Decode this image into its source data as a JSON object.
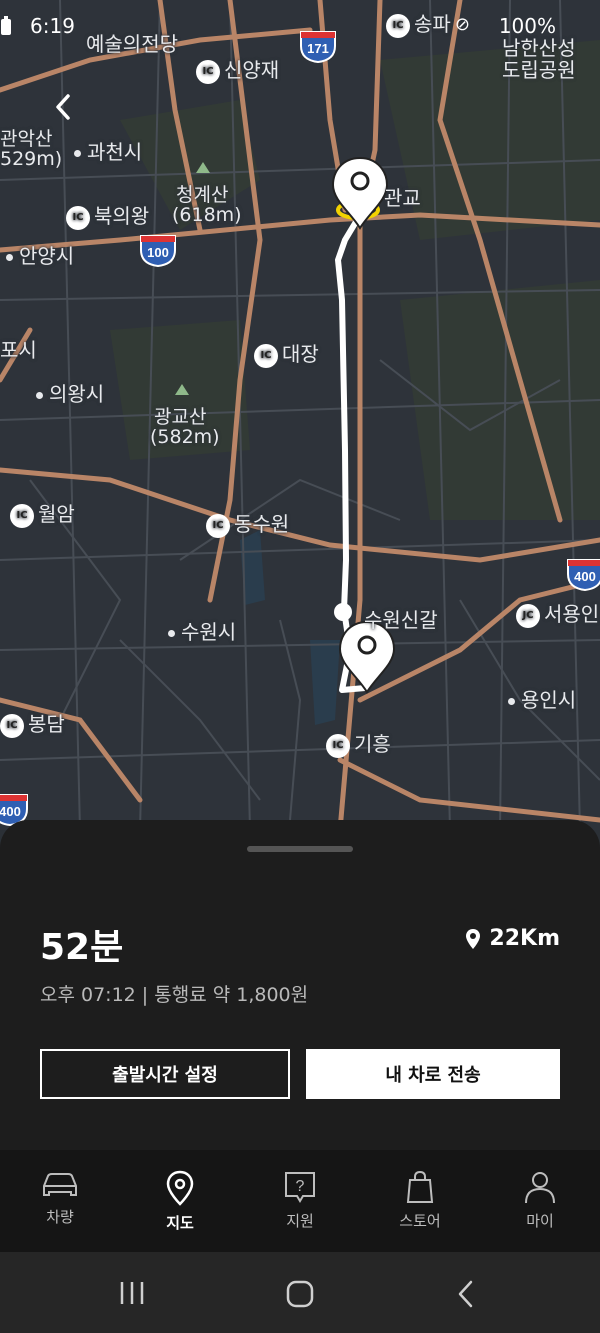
{
  "status_bar": {
    "time": "6:19",
    "battery": "100%"
  },
  "map": {
    "labels": [
      {
        "text": "예술의전당"
      },
      {
        "text": "신양재",
        "ic": "IC"
      },
      {
        "text": "송파",
        "ic": "IC"
      },
      {
        "text": "남한산성"
      },
      {
        "text": "도립공원"
      },
      {
        "text": "관악산"
      },
      {
        "text": "529m)"
      },
      {
        "text": "과천시"
      },
      {
        "text": "청계산"
      },
      {
        "text": "(618m)"
      },
      {
        "text": "북의왕",
        "ic": "IC"
      },
      {
        "text": "관교"
      },
      {
        "text": "안양시"
      },
      {
        "text": "대장",
        "ic": "IC"
      },
      {
        "text": "포시"
      },
      {
        "text": "의왕시"
      },
      {
        "text": "광교산"
      },
      {
        "text": "(582m)"
      },
      {
        "text": "월암",
        "ic": "IC"
      },
      {
        "text": "동수원",
        "ic": "IC"
      },
      {
        "text": "수원신갈"
      },
      {
        "text": "서용인",
        "ic": "JC"
      },
      {
        "text": "수원시"
      },
      {
        "text": "용인시"
      },
      {
        "text": "봉담",
        "ic": "IC"
      },
      {
        "text": "기흥",
        "ic": "IC"
      }
    ],
    "route_shields": [
      "171",
      "100",
      "400",
      "400"
    ],
    "colors": {
      "highway": "#c48a6a",
      "route": "#ffffff",
      "road": "#4a5058",
      "park": "#3a4a3f"
    }
  },
  "sheet": {
    "duration": "52분",
    "distance": "22Km",
    "subtitle": "오후 07:12 | 통행료 약 1,800원",
    "btn_departure": "출발시간 설정",
    "btn_send": "내 차로 전송"
  },
  "tabs": [
    {
      "label": "차량",
      "icon": "car-icon"
    },
    {
      "label": "지도",
      "icon": "map-pin-icon"
    },
    {
      "label": "지원",
      "icon": "help-icon"
    },
    {
      "label": "스토어",
      "icon": "bag-icon"
    },
    {
      "label": "마이",
      "icon": "person-icon"
    }
  ]
}
